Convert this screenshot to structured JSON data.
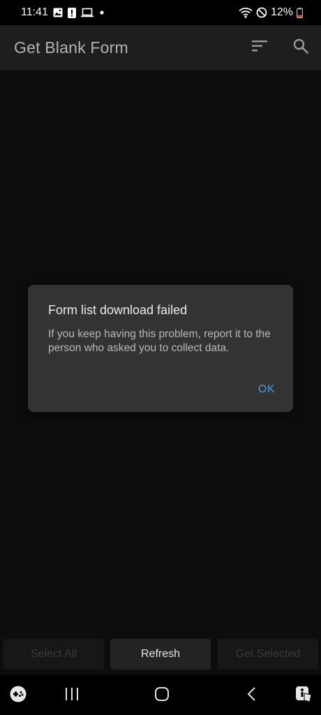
{
  "status_bar": {
    "time": "11:41",
    "battery": "12%",
    "icons_left": [
      "image-icon",
      "alert-icon",
      "laptop-icon",
      "dot-icon"
    ],
    "icons_right": [
      "wifi-icon",
      "do-not-disturb-icon",
      "battery-icon"
    ]
  },
  "app_bar": {
    "title": "Get Blank Form",
    "icons": [
      "sort-icon",
      "search-icon"
    ]
  },
  "dialog": {
    "title": "Form list download failed",
    "message": "If you keep having this problem, report it to the person who asked you to collect data.",
    "ok_label": "OK"
  },
  "bottom_buttons": {
    "select_all": "Select All",
    "refresh": "Refresh",
    "get_selected": "Get Selected"
  },
  "nav_bar": {
    "icons": [
      "game-launcher-icon",
      "recent-apps-icon",
      "home-icon",
      "back-icon",
      "accessibility-icon"
    ]
  },
  "colors": {
    "accent": "#4a9fd9",
    "dialog_bg": "#333333",
    "app_bar_bg": "#1e1e1e"
  }
}
